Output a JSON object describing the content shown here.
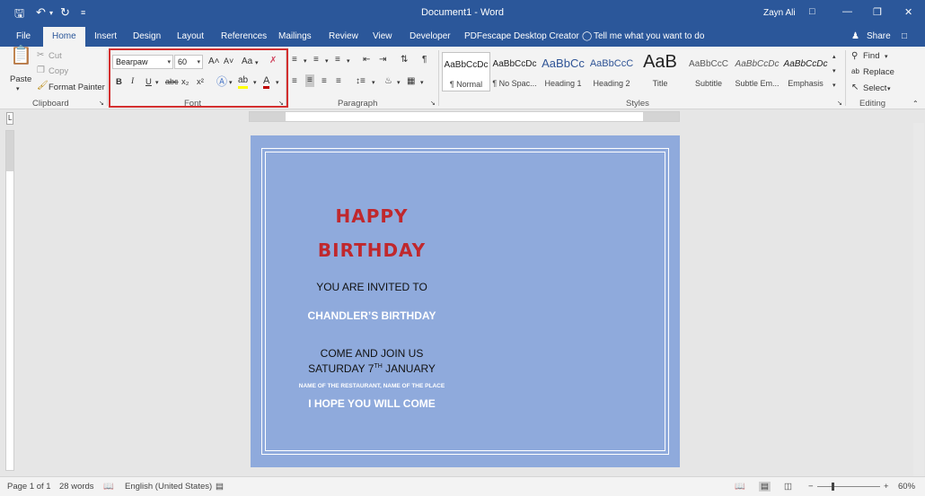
{
  "app": {
    "doc_title": "Document1 - Word",
    "user": "Zayn Ali",
    "window_controls": [
      "ribbon-display-options",
      "minimize",
      "restore",
      "close"
    ]
  },
  "quick_access": {
    "save": "save-icon",
    "undo": "undo-icon",
    "redo": "redo-icon",
    "customize": "customize-icon"
  },
  "tabs": [
    {
      "label": "File"
    },
    {
      "label": "Home",
      "active": true
    },
    {
      "label": "Insert"
    },
    {
      "label": "Design"
    },
    {
      "label": "Layout"
    },
    {
      "label": "References"
    },
    {
      "label": "Mailings"
    },
    {
      "label": "Review"
    },
    {
      "label": "View"
    },
    {
      "label": "Developer"
    },
    {
      "label": "PDFescape Desktop Creator"
    }
  ],
  "tell_me": "Tell me what you want to do",
  "share": "Share",
  "clipboard": {
    "paste": "Paste",
    "cut": "Cut",
    "copy": "Copy",
    "format_painter": "Format Painter",
    "label": "Clipboard"
  },
  "font": {
    "name": "Bearpaw",
    "size": "60",
    "grow": "A˄",
    "shrink": "A˅",
    "change_case": "Aa",
    "bold": "B",
    "italic": "I",
    "underline": "U",
    "strike": "abc",
    "subscript": "x₂",
    "superscript": "x²",
    "font_color": "A",
    "label": "Font"
  },
  "paragraph": {
    "label": "Paragraph"
  },
  "styles": {
    "label": "Styles",
    "items": [
      {
        "preview": "AaBbCcDc",
        "name": "¶ Normal",
        "selected": true
      },
      {
        "preview": "AaBbCcDc",
        "name": "¶ No Spac..."
      },
      {
        "preview": "AaBbCc",
        "name": "Heading 1"
      },
      {
        "preview": "AaBbCcC",
        "name": "Heading 2"
      },
      {
        "preview": "AaB",
        "name": "Title"
      },
      {
        "preview": "AaBbCcC",
        "name": "Subtitle"
      },
      {
        "preview": "AaBbCcDc",
        "name": "Subtle Em..."
      },
      {
        "preview": "AaBbCcDc",
        "name": "Emphasis"
      }
    ]
  },
  "editing": {
    "find": "Find",
    "replace": "Replace",
    "select": "Select",
    "label": "Editing"
  },
  "document": {
    "lines": [
      {
        "text": "HAPPY",
        "color": "#c0282d"
      },
      {
        "text": "BIRTHDAY",
        "color": "#c0282d"
      },
      {
        "text": "YOU ARE INVITED TO",
        "color": "#111111"
      },
      {
        "text": "CHANDLER’S BIRTHDAY",
        "color": "#ffffff"
      },
      {
        "text": "COME AND JOIN US",
        "color": "#111111"
      },
      {
        "text": "SATURDAY 7",
        "sup": "TH",
        "tail": " JANUARY",
        "color": "#111111"
      },
      {
        "text": "NAME OF THE RESTAURANT, NAME OF THE PLACE",
        "color": "#ffffff"
      },
      {
        "text": "I HOPE YOU WILL COME",
        "color": "#ffffff"
      }
    ],
    "background": "#8faadc"
  },
  "status": {
    "page": "Page 1 of 1",
    "words": "28 words",
    "language": "English (United States)",
    "zoom": "60%",
    "zoom_level_percent": 60
  }
}
